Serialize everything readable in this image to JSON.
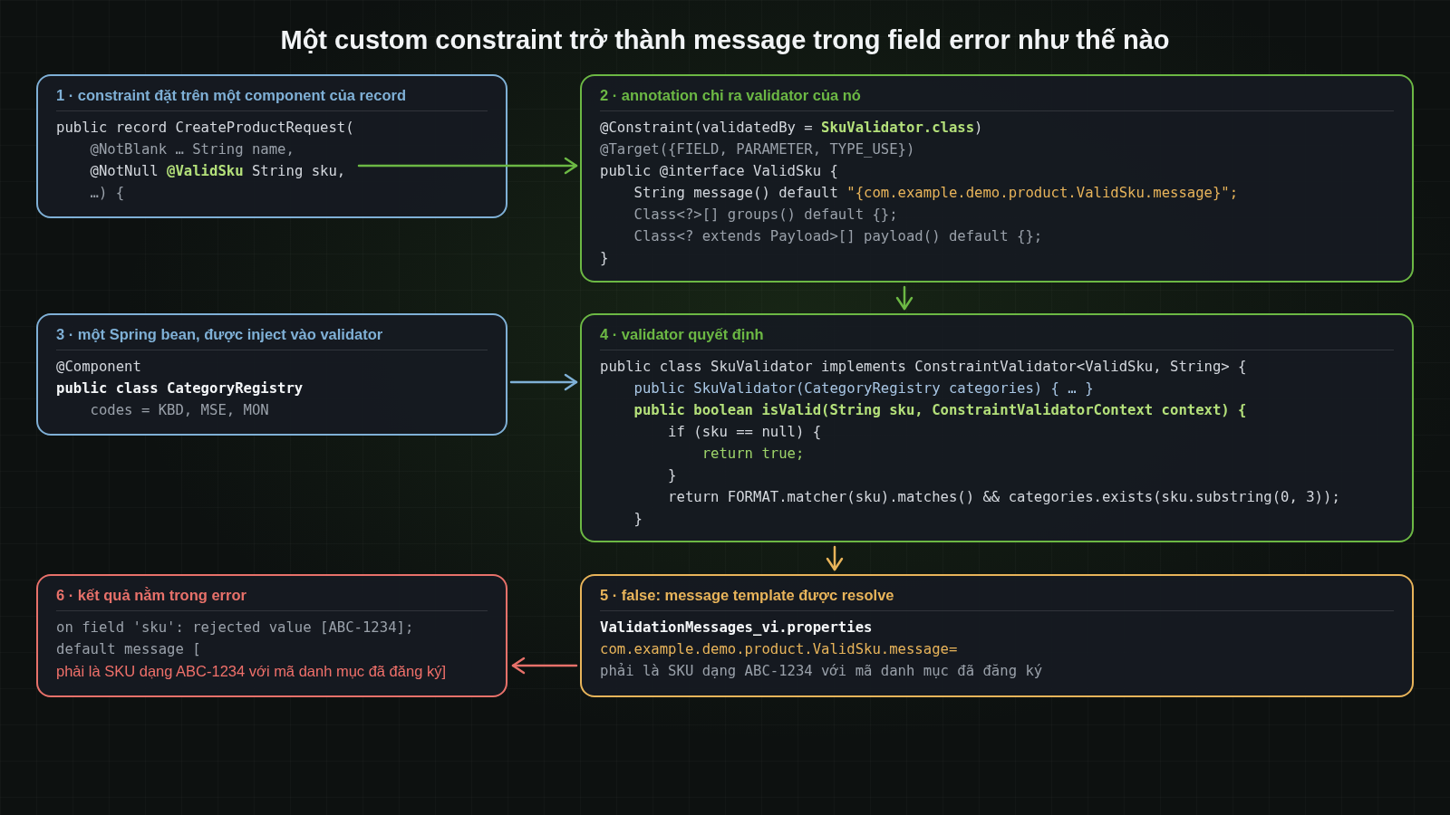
{
  "title": "Một custom constraint trở thành message trong field error như thế nào",
  "cards": [
    {
      "title": "1 · constraint đặt trên một component của record",
      "color": "#7fb0d6",
      "lines": [
        [
          {
            "text": "public record CreateProductRequest(",
            "kind": "plain"
          }
        ],
        [
          {
            "text": "    @NotBlank … String name,",
            "kind": "dim"
          }
        ],
        [
          {
            "text": "    @NotNull ",
            "kind": "plain"
          },
          {
            "text": "@ValidSku",
            "kind": "strong"
          },
          {
            "text": " String sku,",
            "kind": "plain"
          }
        ],
        [
          {
            "text": "    …) {",
            "kind": "dim"
          }
        ]
      ]
    },
    {
      "title": "2 · annotation chỉ ra validator của nó",
      "color": "#6cb844",
      "lines": [
        [
          {
            "text": "@Constraint(validatedBy = ",
            "kind": "plain"
          },
          {
            "text": "SkuValidator.class",
            "kind": "strong"
          },
          {
            "text": ")",
            "kind": "plain"
          }
        ],
        [
          {
            "text": "@Target({FIELD, PARAMETER, TYPE_USE})",
            "kind": "dim"
          }
        ],
        [
          {
            "text": "public @interface ValidSku {",
            "kind": "plain"
          }
        ],
        [
          {
            "text": "    String message() default ",
            "kind": "plain"
          },
          {
            "text": "\"{com.example.demo.product.ValidSku.message}\";",
            "kind": "string"
          }
        ],
        [
          {
            "text": "    Class<?>[] groups() default {};",
            "kind": "dim"
          }
        ],
        [
          {
            "text": "    Class<? extends Payload>[] payload() default {};",
            "kind": "dim"
          }
        ],
        [
          {
            "text": "}",
            "kind": "plain"
          }
        ]
      ]
    },
    {
      "title": "3 · một Spring bean, được inject vào validator",
      "color": "#7fb0d6",
      "lines": [
        [
          {
            "text": "@Component",
            "kind": "plain"
          }
        ],
        [
          {
            "text": "public class CategoryRegistry",
            "kind": "bold"
          }
        ],
        [
          {
            "text": "    codes = KBD, MSE, MON",
            "kind": "dim"
          }
        ]
      ]
    },
    {
      "title": "4 · validator quyết định",
      "color": "#6cb844",
      "lines": [
        [
          {
            "text": "public class SkuValidator implements ConstraintValidator<ValidSku, String> {",
            "kind": "plain"
          }
        ],
        [
          {
            "text": "    public SkuValidator(CategoryRegistry categories) { … }",
            "kind": "constructor"
          }
        ],
        [
          {
            "text": "    public boolean isValid(String sku, ConstraintValidatorContext context) {",
            "kind": "strong"
          }
        ],
        [
          {
            "text": "        if (sku == null) {",
            "kind": "plain"
          }
        ],
        [
          {
            "text": "            return true;",
            "kind": "highlight"
          }
        ],
        [
          {
            "text": "        }",
            "kind": "plain"
          }
        ],
        [
          {
            "text": "        return FORMAT.matcher(sku).matches() && categories.exists(sku.substring(0, 3));",
            "kind": "plain"
          }
        ],
        [
          {
            "text": "    }",
            "kind": "plain"
          }
        ]
      ]
    },
    {
      "title": "6 · kết quả nằm trong error",
      "color": "#e8716a",
      "lines": [
        [
          {
            "text": "on field 'sku': rejected value [ABC-1234];",
            "kind": "dim"
          }
        ],
        [
          {
            "text": "default message [",
            "kind": "dim"
          }
        ],
        [
          {
            "text": "phải là SKU dạng ABC-1234 với mã danh mục đã đăng ký]",
            "kind": "prose"
          }
        ]
      ]
    },
    {
      "title": "5 · false: message template được resolve",
      "color": "#e8b45a",
      "lines": [
        [
          {
            "text": "ValidationMessages_vi.properties",
            "kind": "bold"
          }
        ],
        [
          {
            "text": "com.example.demo.product.ValidSku.message=",
            "kind": "string"
          }
        ],
        [
          {
            "text": "phải là SKU dạng ABC-1234 với mã danh mục đã đăng ký",
            "kind": "dim"
          }
        ]
      ]
    }
  ]
}
